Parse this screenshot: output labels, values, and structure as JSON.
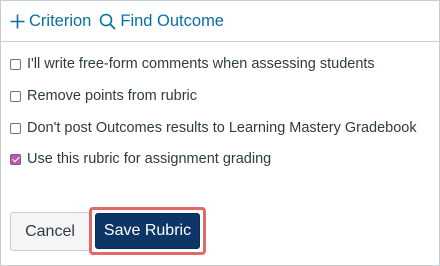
{
  "toolbar": {
    "criterion_label": "Criterion",
    "find_outcome_label": "Find Outcome"
  },
  "options": [
    {
      "label": "I'll write free-form comments when assessing students",
      "checked": false
    },
    {
      "label": "Remove points from rubric",
      "checked": false
    },
    {
      "label": "Don't post Outcomes results to Learning Mastery Gradebook",
      "checked": false
    },
    {
      "label": "Use this rubric for assignment grading",
      "checked": true
    }
  ],
  "actions": {
    "cancel_label": "Cancel",
    "save_label": "Save Rubric"
  },
  "colors": {
    "link": "#0770a3",
    "checkbox_checked": "#b05fae",
    "primary_button": "#0d3566",
    "highlight_outline": "#e2696b"
  }
}
